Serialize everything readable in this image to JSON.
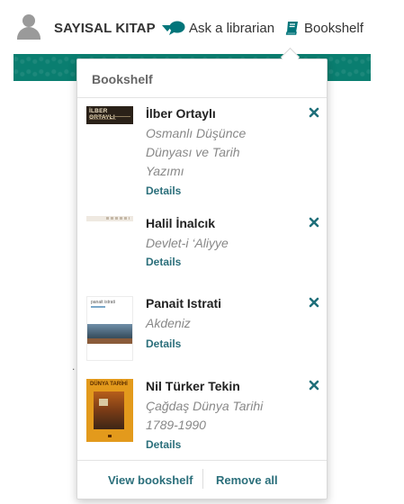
{
  "header": {
    "user_name": "SAYISAL KITAP",
    "ask_label": "Ask a librarian",
    "bookshelf_label": "Bookshelf"
  },
  "bookshelf": {
    "title": "Bookshelf",
    "items": [
      {
        "author": "İlber Ortaylı",
        "title": "Osmanlı Düşünce Dünyası ve Tarih Yazımı",
        "details_label": "Details",
        "cover_text": "İLBER ORTAYLI"
      },
      {
        "author": "Halil İnalcık",
        "title": "Devlet-i ‘Aliyye",
        "details_label": "Details"
      },
      {
        "author": "Panait Istrati",
        "title": "Akdeniz",
        "details_label": "Details",
        "cover_text": "panait istrati"
      },
      {
        "author": "Nil Türker Tekin",
        "title": "Çağdaş Dünya Tarihi 1789-1990",
        "details_label": "Details",
        "cover_text": "DÜNYA TARİHİ"
      }
    ],
    "view_label": "View bookshelf",
    "remove_all_label": "Remove all"
  },
  "colors": {
    "accent": "#00757a",
    "link": "#2b6f7b",
    "banner": "#0a7e70"
  },
  "icons": [
    "user-avatar-icon",
    "chevron-down-icon",
    "chat-bubble-icon",
    "book-icon",
    "close-icon"
  ]
}
